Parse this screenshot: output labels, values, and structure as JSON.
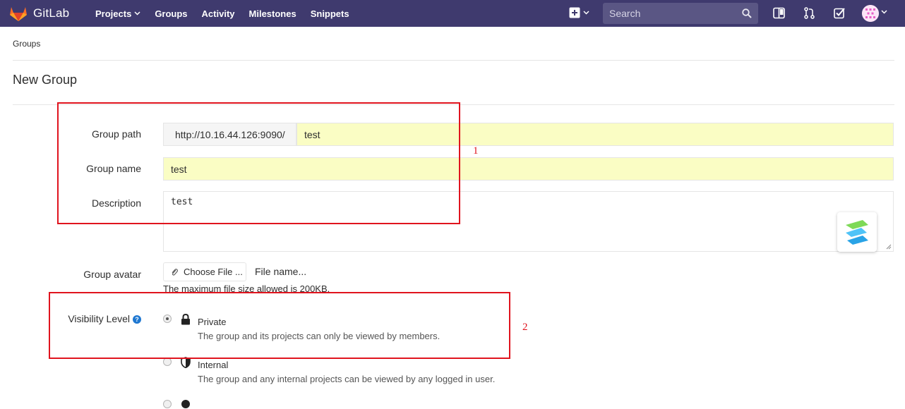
{
  "navbar": {
    "brand": "GitLab",
    "links": [
      {
        "label": "Projects",
        "has_caret": true
      },
      {
        "label": "Groups"
      },
      {
        "label": "Activity"
      },
      {
        "label": "Milestones"
      },
      {
        "label": "Snippets"
      }
    ],
    "search_placeholder": "Search",
    "colors": {
      "background": "#3f3a6e",
      "search_bg": "#5a5684"
    }
  },
  "breadcrumb": "Groups",
  "page_title": "New Group",
  "form": {
    "group_path": {
      "label": "Group path",
      "prefix": "http://10.16.44.126:9090/",
      "value": "test"
    },
    "group_name": {
      "label": "Group name",
      "value": "test"
    },
    "description": {
      "label": "Description",
      "value": "test"
    },
    "group_avatar": {
      "label": "Group avatar",
      "button": "Choose File ...",
      "file_name": "File name...",
      "help": "The maximum file size allowed is 200KB."
    },
    "visibility": {
      "label": "Visibility Level",
      "options": [
        {
          "title": "Private",
          "desc": "The group and its projects can only be viewed by members.",
          "icon": "lock-icon",
          "checked": true
        },
        {
          "title": "Internal",
          "desc": "The group and any internal projects can be viewed by any logged in user.",
          "icon": "shield-icon",
          "checked": false
        }
      ]
    }
  },
  "annotations": {
    "box1": "1",
    "box2": "2",
    "color": "#e0141e"
  }
}
